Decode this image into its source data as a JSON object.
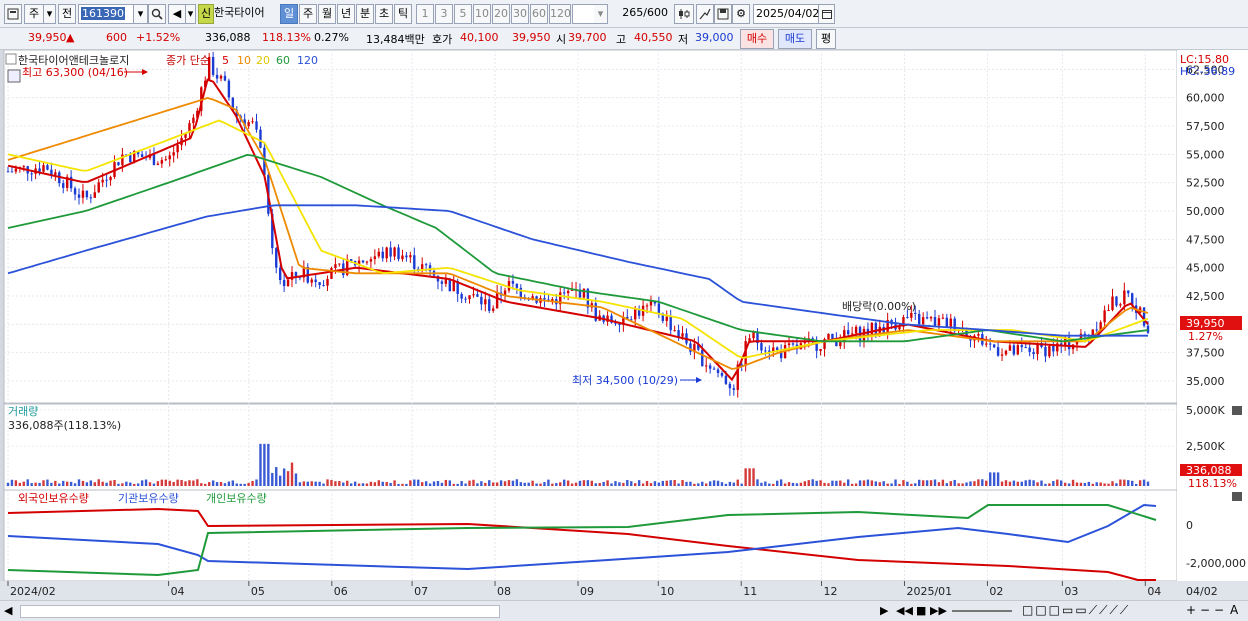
{
  "toolbar": {
    "period_labels": [
      "주",
      "전"
    ],
    "code": "161390",
    "badge": "신",
    "stock_name": "한국타이어",
    "period_tabs": [
      "일",
      "주",
      "월",
      "년",
      "분",
      "초",
      "틱"
    ],
    "minute_intervals": [
      "1",
      "3",
      "5",
      "10",
      "20",
      "30",
      "60",
      "120"
    ],
    "count": "265",
    "count_total": "/600",
    "date": "2025/04/02"
  },
  "quote": {
    "price": "39,950",
    "change_arrow": "▲",
    "change": "600",
    "change_pct": "+1.52%",
    "volume": "336,088",
    "volume_pct": "118.13%",
    "turnover": "0.27%",
    "amount": "13,484백만",
    "hoga_label": "호가",
    "ask": "40,100",
    "bid": "39,950",
    "open_label": "시",
    "open": "39,700",
    "high_label": "고",
    "high": "40,550",
    "low_label": "저",
    "low": "39,000",
    "buy_label": "매수",
    "sell_label": "매도",
    "avg_label": "평"
  },
  "price_panel": {
    "title": "한국타이어앤테크놀로지",
    "ma_label": "종가 단순",
    "ma_periods": [
      "5",
      "10",
      "20",
      "60",
      "120"
    ],
    "ma_colors": [
      "#d40000",
      "#ee8a00",
      "#f5e400",
      "#1f9a3a",
      "#2b52d8"
    ],
    "lc": "LC:15.80",
    "hc": "HC:-36.89",
    "high_note": "최고 63,300 (04/16)",
    "low_note": "최저 34,500 (10/29)",
    "dividend_note": "배당락(0.00%)",
    "current_price_tag": "39,950",
    "current_pct_tag": "1.27%",
    "y_ticks": [
      "62,500",
      "60,000",
      "57,500",
      "55,000",
      "52,500",
      "50,000",
      "47,500",
      "45,000",
      "42,500",
      "40,000",
      "37,500",
      "35,000"
    ]
  },
  "volume_panel": {
    "title": "거래량",
    "value_note": "336,088주(118.13%)",
    "y_ticks": [
      "5,000K",
      "2,500K"
    ],
    "current_tag": "336,088",
    "current_pct_tag": "118.13%"
  },
  "holding_panel": {
    "series_labels": [
      "외국인보유수량",
      "기관보유수량",
      "개인보유수량"
    ],
    "y_ticks": [
      "0",
      "-2,000,000"
    ]
  },
  "x_axis": {
    "labels": [
      "2024/02",
      "04",
      "05",
      "06",
      "07",
      "08",
      "09",
      "10",
      "11",
      "12",
      "2025/01",
      "02",
      "03",
      "04"
    ],
    "right_label": "04/02"
  },
  "chart_data": {
    "type": "line",
    "title": "한국타이어앤테크놀로지",
    "x_labels": [
      "2024/02",
      "04",
      "05",
      "06",
      "07",
      "08",
      "09",
      "10",
      "11",
      "12",
      "2025/01",
      "02",
      "03",
      "04"
    ],
    "ylim": [
      33500,
      63500
    ],
    "close_series": {
      "name": "종가",
      "dates": [
        "2024/02/01",
        "2024/02/15",
        "2024/03/01",
        "2024/03/15",
        "2024/04/01",
        "2024/04/10",
        "2024/04/16",
        "2024/04/22",
        "2024/04/26",
        "2024/05/03",
        "2024/05/07",
        "2024/05/10",
        "2024/05/14",
        "2024/05/20",
        "2024/05/28",
        "2024/06/10",
        "2024/06/25",
        "2024/07/05",
        "2024/07/15",
        "2024/07/31",
        "2024/08/05",
        "2024/08/20",
        "2024/09/02",
        "2024/09/10",
        "2024/09/20",
        "2024/09/30",
        "2024/10/15",
        "2024/10/29",
        "2024/11/04",
        "2024/11/15",
        "2024/12/02",
        "2024/12/20",
        "2025/01/02",
        "2025/01/20",
        "2025/02/03",
        "2025/02/10",
        "2025/02/28",
        "2025/03/10",
        "2025/03/20",
        "2025/03/26",
        "2025/04/02"
      ],
      "values": [
        53500,
        54000,
        51000,
        55000,
        54500,
        58000,
        63000,
        61000,
        58500,
        57500,
        53500,
        45500,
        43500,
        44500,
        44000,
        45500,
        46500,
        45000,
        43500,
        41500,
        43500,
        42000,
        43000,
        40000,
        41000,
        41500,
        37500,
        34500,
        39000,
        37500,
        38500,
        39500,
        40500,
        40000,
        38000,
        37500,
        38000,
        39000,
        42000,
        42500,
        39950
      ]
    },
    "series": [
      {
        "name": "5",
        "color": "#d40000",
        "dates": [
          "2024/02/01",
          "2024/03/01",
          "2024/04/10",
          "2024/04/16",
          "2024/04/26",
          "2024/05/07",
          "2024/05/14",
          "2024/06/10",
          "2024/07/15",
          "2024/08/05",
          "2024/09/10",
          "2024/10/15",
          "2024/10/29",
          "2024/11/04",
          "2024/12/02",
          "2025/01/02",
          "2025/02/03",
          "2025/03/10",
          "2025/03/26",
          "2025/04/02"
        ],
        "values": [
          54000,
          52500,
          56500,
          62000,
          58500,
          53000,
          44000,
          45000,
          44000,
          42000,
          40500,
          38500,
          35000,
          38500,
          38500,
          40000,
          38500,
          38000,
          42000,
          40000
        ]
      },
      {
        "name": "10",
        "color": "#ee8a00",
        "dates": [
          "2024/02/01",
          "2024/04/16",
          "2024/04/26",
          "2024/05/07",
          "2024/05/20",
          "2024/06/10",
          "2024/07/15",
          "2024/08/05",
          "2024/09/10",
          "2024/10/29",
          "2024/11/15",
          "2024/12/02",
          "2025/01/02",
          "2025/02/03",
          "2025/03/10",
          "2025/03/26",
          "2025/04/02"
        ],
        "values": [
          54500,
          60000,
          59000,
          54500,
          45000,
          44500,
          44500,
          42500,
          41500,
          36000,
          37500,
          38500,
          39500,
          38500,
          38500,
          41500,
          41000
        ]
      },
      {
        "name": "20",
        "color": "#f5e400",
        "dates": [
          "2024/02/01",
          "2024/03/01",
          "2024/04/20",
          "2024/05/07",
          "2024/05/28",
          "2024/06/20",
          "2024/07/15",
          "2024/08/10",
          "2024/09/10",
          "2024/10/10",
          "2024/11/01",
          "2024/12/02",
          "2025/01/10",
          "2025/02/10",
          "2025/03/10",
          "2025/04/02"
        ],
        "values": [
          55000,
          53500,
          58000,
          56000,
          46500,
          44500,
          45000,
          43000,
          42000,
          40500,
          37000,
          38500,
          39500,
          39500,
          38500,
          40500
        ]
      },
      {
        "name": "60",
        "color": "#1f9a3a",
        "dates": [
          "2024/02/01",
          "2024/03/01",
          "2024/04/01",
          "2024/05/01",
          "2024/05/28",
          "2024/06/20",
          "2024/07/10",
          "2024/08/01",
          "2024/09/01",
          "2024/10/01",
          "2024/11/01",
          "2024/12/01",
          "2025/01/01",
          "2025/02/01",
          "2025/03/01",
          "2025/04/02"
        ],
        "values": [
          48500,
          50000,
          52500,
          55000,
          53000,
          50500,
          48500,
          44500,
          43000,
          42000,
          39500,
          38500,
          38500,
          39500,
          38500,
          39500
        ]
      },
      {
        "name": "120",
        "color": "#2b52d8",
        "dates": [
          "2024/02/01",
          "2024/03/01",
          "2024/04/15",
          "2024/05/10",
          "2024/06/10",
          "2024/07/15",
          "2024/08/15",
          "2024/09/20",
          "2024/10/20",
          "2024/11/01",
          "2024/12/01",
          "2025/01/01",
          "2025/02/01",
          "2025/03/01",
          "2025/04/02"
        ],
        "values": [
          44500,
          46500,
          49500,
          50500,
          50500,
          50000,
          47500,
          45500,
          44000,
          42000,
          41000,
          40000,
          39500,
          39000,
          39000
        ]
      }
    ]
  },
  "icons": [
    "chart-icon",
    "search-icon",
    "speaker-icon",
    "candle-icon",
    "tool-icon",
    "save-icon",
    "gear-icon",
    "calendar-icon"
  ]
}
